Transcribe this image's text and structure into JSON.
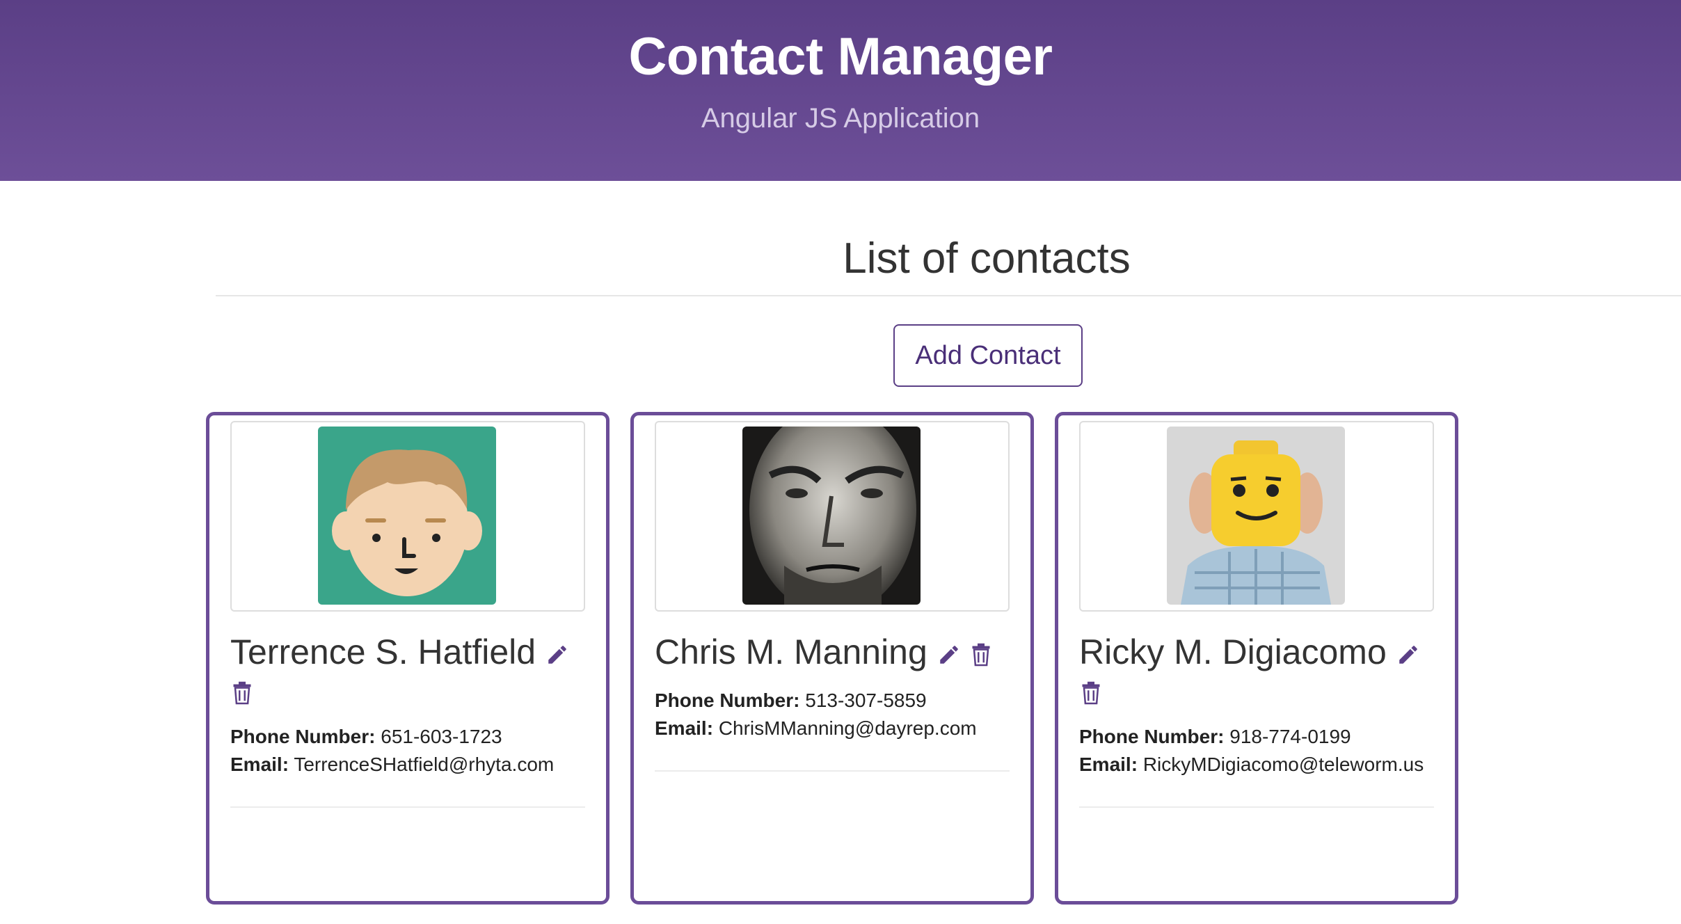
{
  "header": {
    "title": "Contact Manager",
    "subtitle": "Angular JS Application",
    "gradient_top": "#5b3f86",
    "gradient_bottom": "#6d4f98"
  },
  "main": {
    "section_title": "List of contacts",
    "add_button_label": "Add Contact",
    "accent_color": "#6b4d98"
  },
  "contacts": [
    {
      "name": "Terrence S. Hatfield",
      "phone_label": "Phone Number:",
      "phone": "651-603-1723",
      "email_label": "Email:",
      "email": "TerrenceSHatfield@rhyta.com",
      "avatar": "cartoon-face-avatar"
    },
    {
      "name": "Chris M. Manning",
      "phone_label": "Phone Number:",
      "phone": "513-307-5859",
      "email_label": "Email:",
      "email": "ChrisMManning@dayrep.com",
      "avatar": "bw-portrait-avatar"
    },
    {
      "name": "Ricky M. Digiacomo",
      "phone_label": "Phone Number:",
      "phone": "918-774-0199",
      "email_label": "Email:",
      "email": "RickyMDigiacomo@teleworm.us",
      "avatar": "lego-head-avatar"
    }
  ],
  "icons": {
    "edit": "pencil-icon",
    "delete": "trash-icon"
  }
}
